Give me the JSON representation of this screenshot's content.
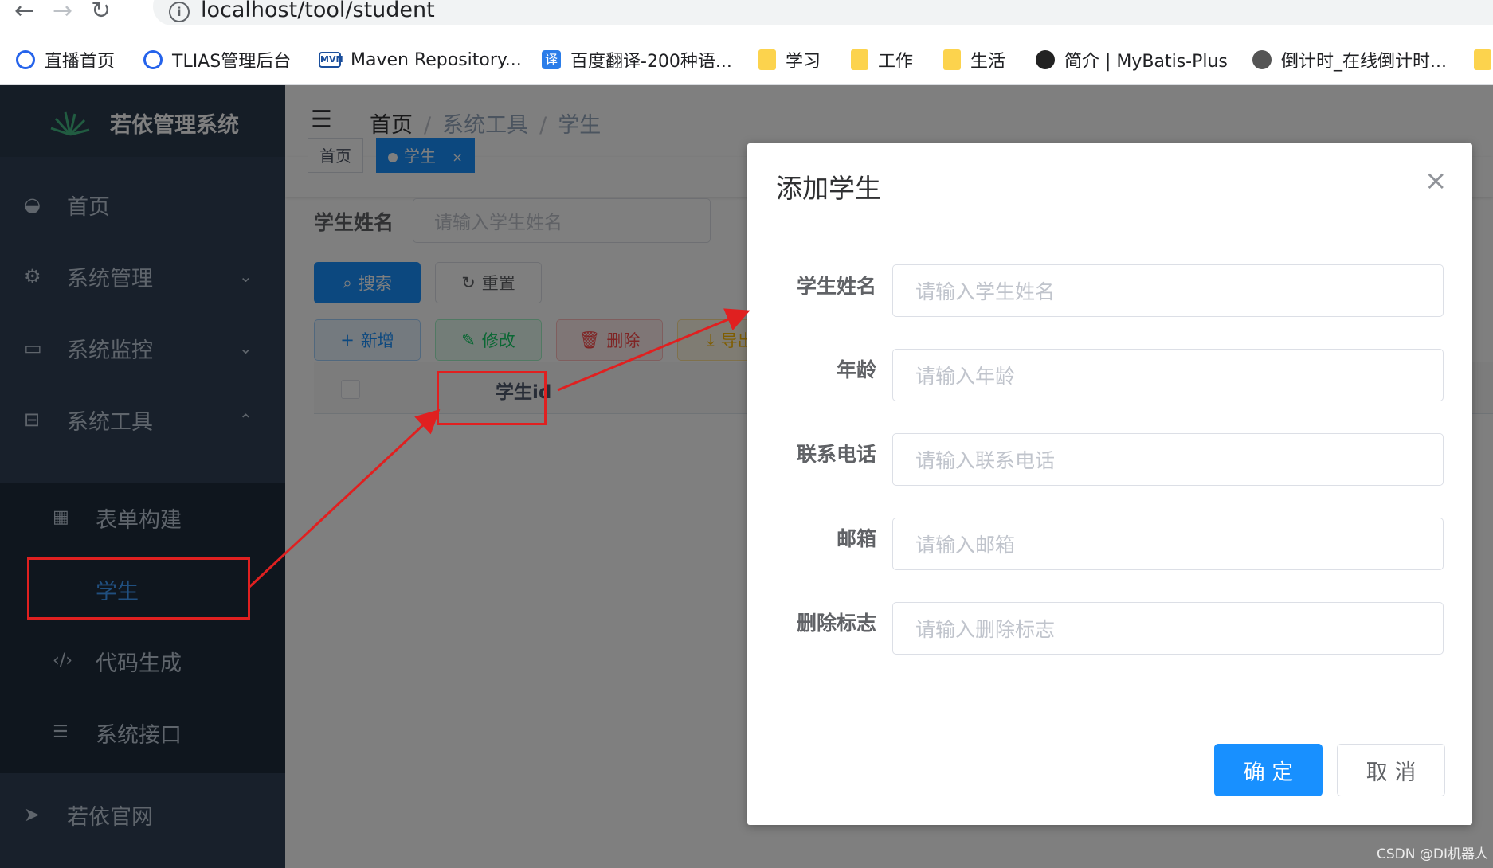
{
  "browser": {
    "url": "localhost/tool/student",
    "bookmarks": [
      {
        "label": "直播首页",
        "icon": "bilibili-icon"
      },
      {
        "label": "TLIAS管理后台",
        "icon": "bilibili-icon"
      },
      {
        "label": "Maven Repository...",
        "icon": "mvn-icon"
      },
      {
        "label": "百度翻译-200种语...",
        "icon": "translate-icon"
      },
      {
        "label": "学习",
        "icon": "folder-icon"
      },
      {
        "label": "工作",
        "icon": "folder-icon"
      },
      {
        "label": "生活",
        "icon": "folder-icon"
      },
      {
        "label": "简介 | MyBatis-Plus",
        "icon": "mybatis-icon"
      },
      {
        "label": "倒计时_在线倒计时...",
        "icon": "globe-icon"
      }
    ],
    "mvn_icon_text": "MVN",
    "translate_icon_text": "译"
  },
  "sidebar": {
    "logo_text": "若依管理系统",
    "items": [
      {
        "label": "首页",
        "icon": "dashboard-icon"
      },
      {
        "label": "系统管理",
        "icon": "gear-icon"
      },
      {
        "label": "系统监控",
        "icon": "monitor-icon"
      },
      {
        "label": "系统工具",
        "icon": "toolbox-icon"
      }
    ],
    "subitems": [
      {
        "label": "表单构建",
        "icon": "table-icon"
      },
      {
        "label": "学生",
        "icon": ""
      },
      {
        "label": "代码生成",
        "icon": "code-icon"
      },
      {
        "label": "系统接口",
        "icon": "sliders-icon"
      }
    ],
    "footer_item": {
      "label": "若依官网",
      "icon": "paper-plane-icon"
    }
  },
  "header": {
    "breadcrumb": [
      "首页",
      "系统工具",
      "学生"
    ]
  },
  "tags": [
    {
      "label": "首页"
    },
    {
      "label": "学生",
      "close": "×"
    }
  ],
  "search": {
    "label": "学生姓名",
    "placeholder": "请输入学生姓名",
    "search_btn": "搜索",
    "reset_btn": "重置"
  },
  "toolbar": {
    "add": "新增",
    "edit": "修改",
    "delete": "删除",
    "export": "导出"
  },
  "table": {
    "columns": [
      "学生id"
    ]
  },
  "dialog": {
    "title": "添加学生",
    "close": "×",
    "fields": [
      {
        "label": "学生姓名",
        "placeholder": "请输入学生姓名"
      },
      {
        "label": "年龄",
        "placeholder": "请输入年龄"
      },
      {
        "label": "联系电话",
        "placeholder": "请输入联系电话"
      },
      {
        "label": "邮箱",
        "placeholder": "请输入邮箱"
      },
      {
        "label": "删除标志",
        "placeholder": "请输入删除标志"
      }
    ],
    "confirm": "确 定",
    "cancel": "取 消"
  },
  "watermark": "CSDN @DI机器人",
  "colors": {
    "sidebar_bg": "#304156",
    "primary": "#1890ff",
    "annotation": "#e02020"
  }
}
